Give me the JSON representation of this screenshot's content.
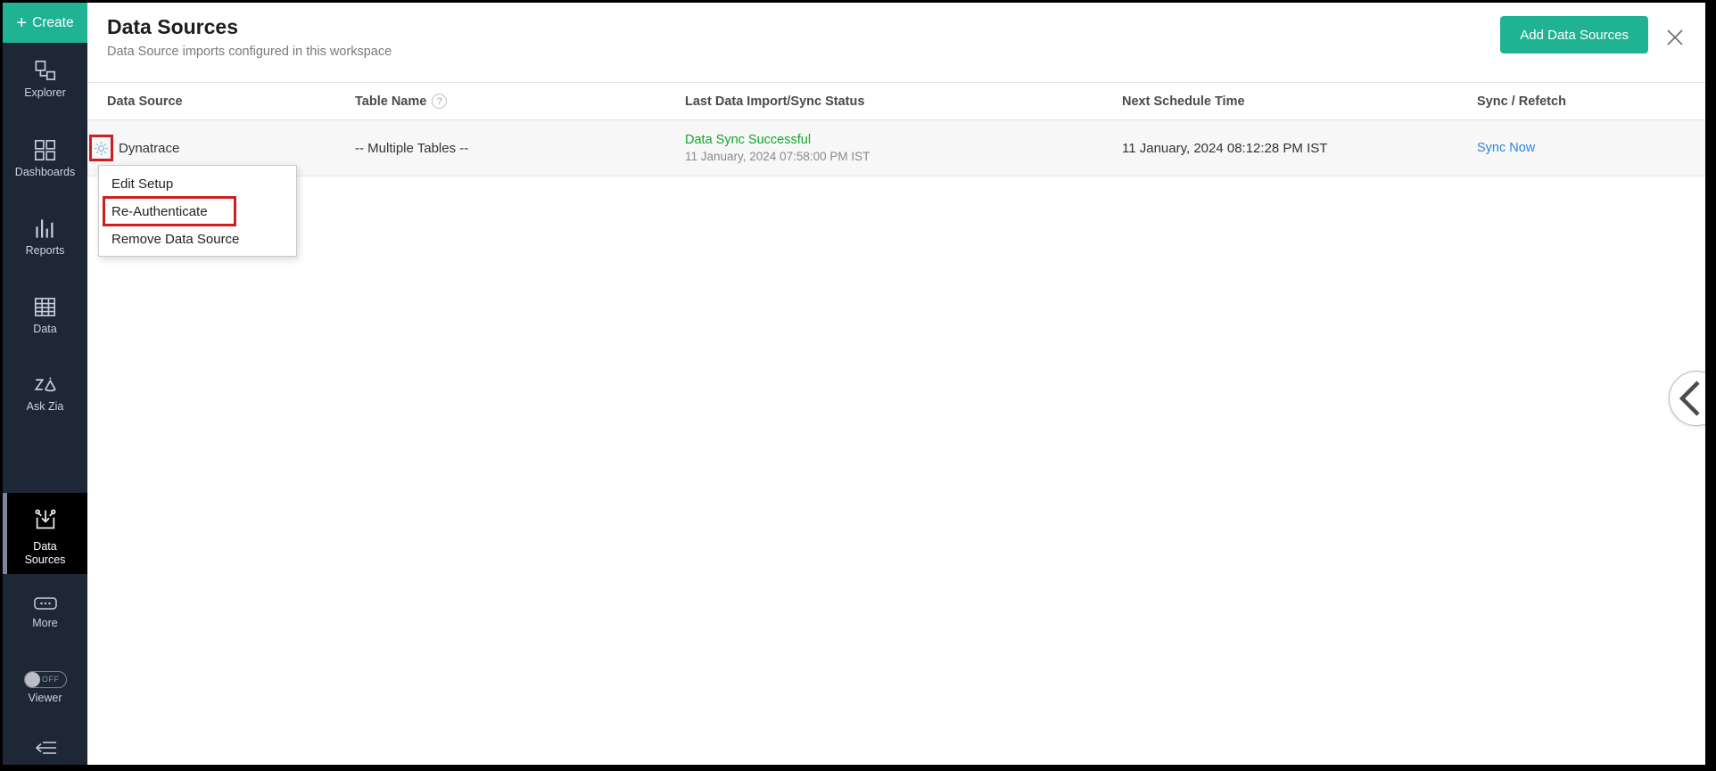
{
  "colors": {
    "accent_green": "#1fb394",
    "sidebar_bg": "#1d2736",
    "active_item_bg": "#000000",
    "status_green": "#13a52e",
    "link_blue": "#2e86e0",
    "annotation_red": "#cc2020"
  },
  "icons": {
    "plus": "+",
    "help": "?"
  },
  "sidebar": {
    "create_label": "Create",
    "items": [
      {
        "label": "Explorer"
      },
      {
        "label": "Dashboards"
      },
      {
        "label": "Reports"
      },
      {
        "label": "Data"
      },
      {
        "label": "Ask Zia"
      },
      {
        "label": "Data Sources",
        "active": true
      },
      {
        "label": "More"
      }
    ],
    "viewer": {
      "label": "Viewer",
      "toggle_state": "OFF"
    }
  },
  "header": {
    "title": "Data Sources",
    "subtitle": "Data Source imports configured in this workspace",
    "add_button": "Add Data Sources"
  },
  "table": {
    "columns": [
      {
        "label": "Data Source"
      },
      {
        "label": "Table Name",
        "help": true
      },
      {
        "label": "Last Data Import/Sync Status"
      },
      {
        "label": "Next Schedule Time"
      },
      {
        "label": "Sync / Refetch"
      }
    ],
    "rows": [
      {
        "name": "Dynatrace",
        "table_name": "-- Multiple Tables --",
        "status": "Data Sync Successful",
        "status_time": "11 January, 2024 07:58:00 PM IST",
        "next_schedule": "11 January, 2024 08:12:28 PM IST",
        "action": "Sync Now"
      }
    ]
  },
  "context_menu": {
    "items": [
      {
        "label": "Edit Setup"
      },
      {
        "label": "Re-Authenticate",
        "highlighted": true
      },
      {
        "label": "Remove Data Source"
      }
    ]
  }
}
